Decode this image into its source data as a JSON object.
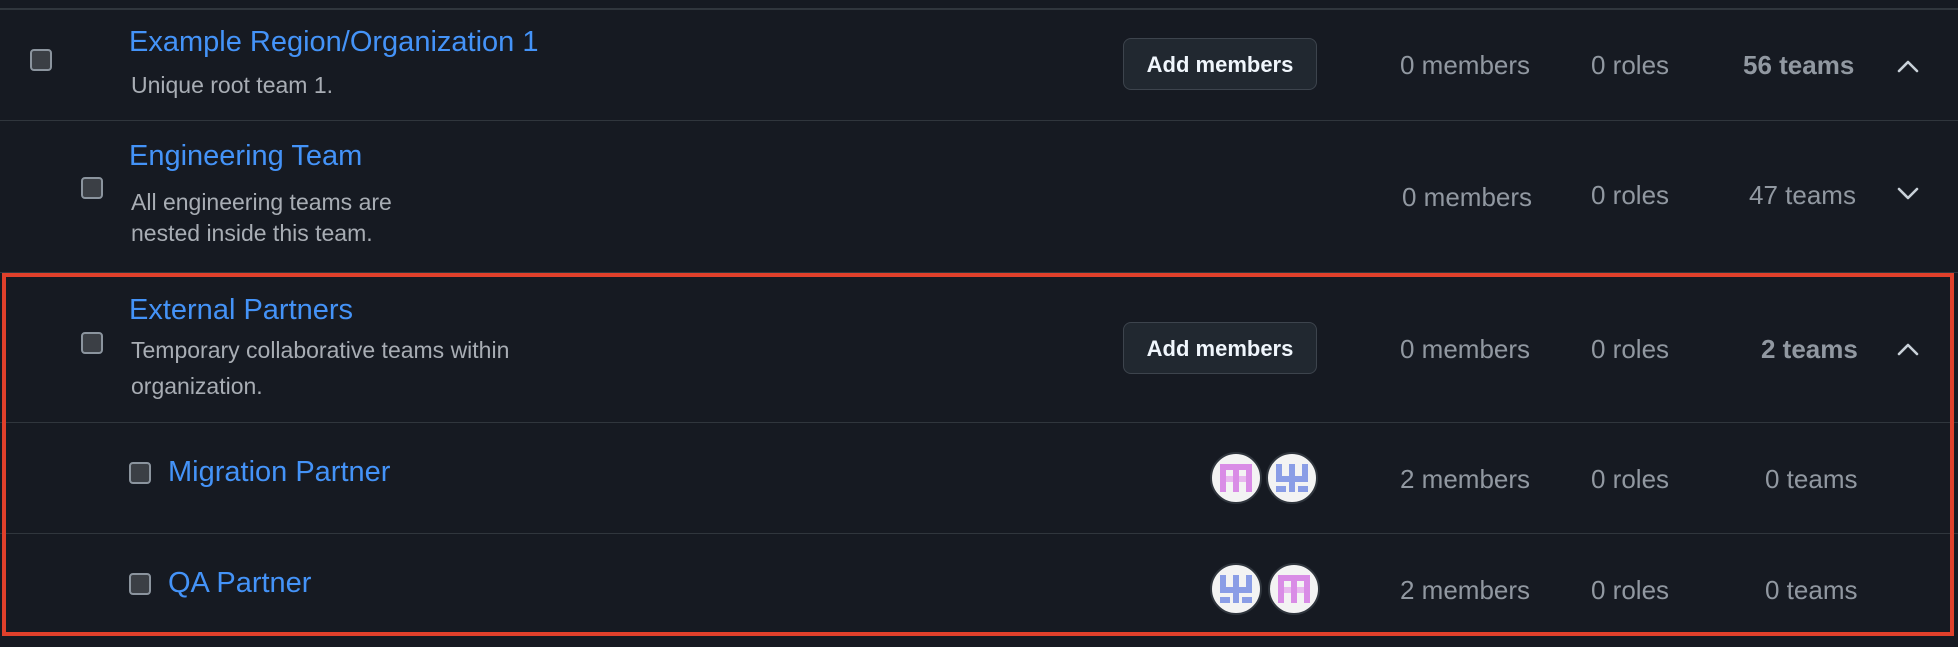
{
  "teams": [
    {
      "name": "Example Region/Organization 1",
      "description": "Unique root team 1.",
      "add_members_label": "Add members",
      "members": "0 members",
      "roles": "0 roles",
      "teams": "56 teams",
      "expanded": true
    },
    {
      "name": "Engineering Team",
      "description_line1": "All engineering teams are",
      "description_line2": "nested inside this team.",
      "members": "0 members",
      "roles": "0 roles",
      "teams": "47 teams",
      "expanded": false
    },
    {
      "name": "External Partners",
      "description_line1": "Temporary collaborative teams within",
      "description_line2": "organization.",
      "add_members_label": "Add members",
      "members": "0 members",
      "roles": "0 roles",
      "teams": "2 teams",
      "expanded": true
    },
    {
      "name": "Migration Partner",
      "members": "2 members",
      "roles": "0 roles",
      "teams": "0 teams",
      "avatars": [
        "avatar-pink-icon",
        "avatar-blue-icon"
      ]
    },
    {
      "name": "QA Partner",
      "members": "2 members",
      "roles": "0 roles",
      "teams": "0 teams",
      "avatars": [
        "avatar-blue-icon",
        "avatar-pink-icon"
      ]
    }
  ],
  "colors": {
    "background": "#161a22",
    "link": "#4493f8",
    "muted": "#9198a1",
    "highlight_border": "#e0402b",
    "avatar_pink": "#d98ce6",
    "avatar_blue": "#8a9de6"
  }
}
